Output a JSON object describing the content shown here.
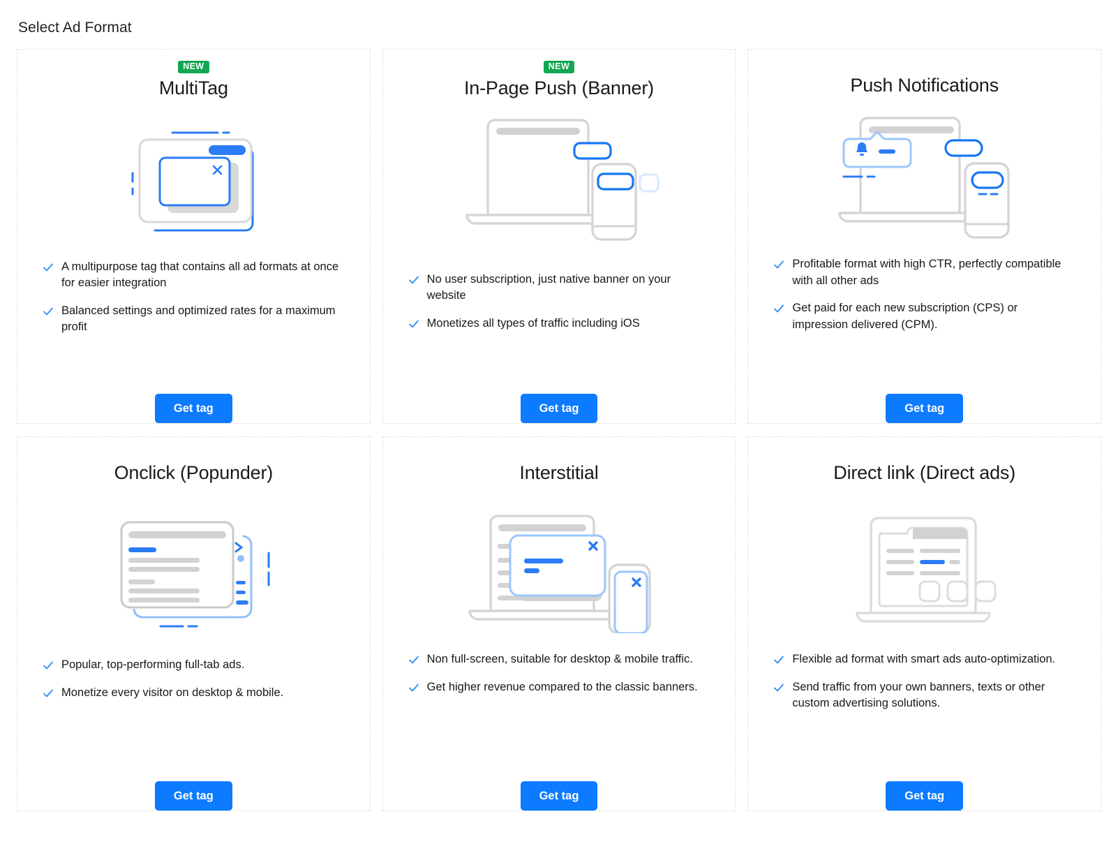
{
  "page": {
    "title": "Select Ad Format"
  },
  "colors": {
    "accent_blue": "#0d7bff",
    "badge_green": "#12a750",
    "art_gray": "#d2d2d2",
    "card_border": "#e0e0e0",
    "text": "#181818"
  },
  "labels": {
    "get_tag": "Get tag",
    "new_badge": "NEW"
  },
  "cards": [
    {
      "id": "multitag",
      "badge": "NEW",
      "title": "MultiTag",
      "illustration": "multitag-illustration",
      "bullets": [
        "A multipurpose tag that contains all ad formats at once for easier integration",
        "Balanced settings and optimized rates for a maximum profit"
      ],
      "button": "Get tag"
    },
    {
      "id": "in-page-push-banner",
      "badge": "NEW",
      "title": "In-Page Push (Banner)",
      "illustration": "in-page-push-illustration",
      "bullets": [
        "No user subscription, just native banner on your website",
        "Monetizes all types of traffic including iOS"
      ],
      "button": "Get tag"
    },
    {
      "id": "push-notifications",
      "badge": "",
      "title": "Push Notifications",
      "illustration": "push-notifications-illustration",
      "bullets": [
        "Profitable format with high CTR, perfectly compatible with all other ads",
        "Get paid for each new subscription (CPS) or impression delivered (CPM)."
      ],
      "button": "Get tag"
    },
    {
      "id": "onclick-popunder",
      "badge": "",
      "title": "Onclick (Popunder)",
      "illustration": "onclick-popunder-illustration",
      "bullets": [
        "Popular, top-performing full-tab ads.",
        "Monetize every visitor on desktop & mobile."
      ],
      "button": "Get tag"
    },
    {
      "id": "interstitial",
      "badge": "",
      "title": "Interstitial",
      "illustration": "interstitial-illustration",
      "bullets": [
        "Non full-screen, suitable for desktop & mobile traffic.",
        "Get higher revenue compared to the classic banners."
      ],
      "button": "Get tag"
    },
    {
      "id": "direct-link-direct-ads",
      "badge": "",
      "title": "Direct link (Direct ads)",
      "illustration": "direct-link-illustration",
      "bullets": [
        "Flexible ad format with smart ads auto-optimization.",
        "Send traffic from your own banners, texts or other custom advertising solutions."
      ],
      "button": "Get tag"
    }
  ]
}
